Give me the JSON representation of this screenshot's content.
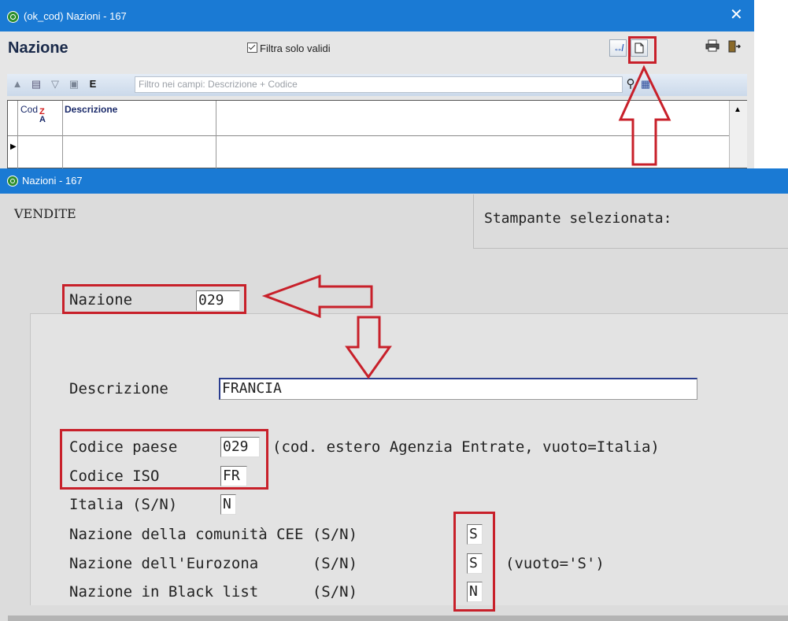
{
  "window_top": {
    "title": "(ok_cod) Nazioni - 167",
    "close_glyph": "✕",
    "heading": "Nazione",
    "filter_checkbox": {
      "label": "Filtra solo validi",
      "checked": true
    },
    "search_field_placeholder": "Filtro nei campi: Descrizione + Codice",
    "grid": {
      "columns": [
        "Cod",
        "Descrizione"
      ],
      "sort_icon_text": "Z↓A"
    }
  },
  "window_form": {
    "title": "Nazioni - 167",
    "section": "VENDITE",
    "printer_label": "Stampante selezionata:",
    "fields": {
      "nazione": {
        "label": "Nazione",
        "value": "029"
      },
      "descrizione": {
        "label": "Descrizione",
        "value": "FRANCIA"
      },
      "codice_paese": {
        "label": "Codice paese",
        "value": "029",
        "note": "(cod. estero Agenzia Entrate, vuoto=Italia)"
      },
      "codice_iso": {
        "label": "Codice ISO",
        "value": "FR"
      },
      "italia": {
        "label": "Italia (S/N)",
        "value": "N"
      },
      "cee": {
        "label": "Nazione della comunità CEE (S/N)",
        "value": "S"
      },
      "eurozona": {
        "label": "Nazione dell'Eurozona      (S/N)",
        "value": "S",
        "note": "(vuoto='S')"
      },
      "blacklist": {
        "label": "Nazione in Black list      (S/N)",
        "value": "N"
      }
    }
  },
  "annotation_color": "#c8202a",
  "titlebar_color": "#1a7ad4"
}
